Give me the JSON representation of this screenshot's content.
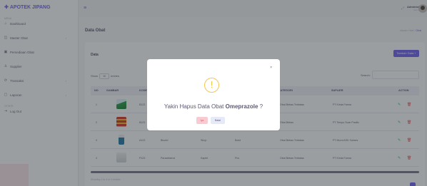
{
  "app": {
    "brand": "APOTEK JIPANG",
    "brand_icon": "plus-medical-icon"
  },
  "sidebar": {
    "section_menu": "MENU",
    "section_other": "OTHER",
    "items": [
      {
        "label": "Dashboard",
        "icon": "home-icon"
      },
      {
        "label": "Master Obat",
        "icon": "pill-icon"
      },
      {
        "label": "Persediaan Obat",
        "icon": "box-icon"
      },
      {
        "label": "Supplier",
        "icon": "user-icon"
      },
      {
        "label": "Transaksi",
        "icon": "refresh-icon"
      },
      {
        "label": "Laporan",
        "icon": "file-icon"
      },
      {
        "label": "Log Out",
        "icon": "logout-icon"
      }
    ]
  },
  "header": {
    "user_name": "Administrator",
    "user_role": "Admin"
  },
  "page": {
    "title": "Data Obat",
    "breadcrumb_parent": "Master Obat",
    "breadcrumb_current": "Obat"
  },
  "card": {
    "title": "Data",
    "add_button": "Tambah Data +",
    "show_label": "Show",
    "show_value": "10",
    "entries_label": "entries",
    "search_label": "Search:",
    "columns": [
      "NO",
      "GAMBAR",
      "KODE",
      "NAMA OBAT",
      "GOLONGAN",
      "SATUAN",
      "KATEGORI",
      "SUPLIER",
      "ACTION"
    ],
    "rows": [
      {
        "no": "1",
        "kode": "B123",
        "nama": "",
        "golongan": "",
        "satuan": "",
        "kategori": "Obat Bebas Terbatas",
        "suplier": "PT Kimia Farma"
      },
      {
        "no": "2",
        "kode": "B123",
        "nama": "",
        "golongan": "",
        "satuan": "",
        "kategori": "Obat Bebas",
        "suplier": "PT Tempo Scan Pacific"
      },
      {
        "no": "3",
        "kode": "A123",
        "nama": "Bisolvi",
        "golongan": "Sirup",
        "satuan": "Botol",
        "kategori": "Obat Bebas Terbatas",
        "suplier": "PT Murni ASK Sukses"
      },
      {
        "no": "4",
        "kode": "P123",
        "nama": "Paracetamol",
        "golongan": "Kaplet",
        "satuan": "Pcs",
        "kategori": "Obat Bebas Terbatas",
        "suplier": "PT Kimia Farma"
      }
    ],
    "showing": "Showing 1 to 4 of 4 entries"
  },
  "modal": {
    "icon": "warning-icon",
    "message_prefix": "Yakin Hapus Data Obat ",
    "item_name": "Omeprazole",
    "message_suffix": " ?",
    "yes_label": "Iya",
    "no_label": "Batal"
  },
  "colors": {
    "accent": "#7367f0",
    "danger": "#ea5455",
    "success": "#28c76f",
    "warning": "#f3c746"
  }
}
